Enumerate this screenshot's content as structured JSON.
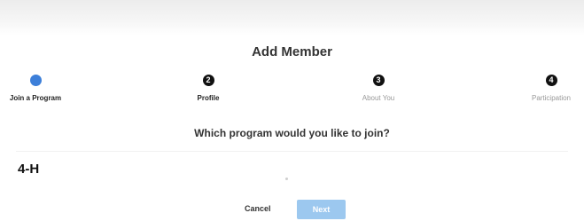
{
  "dialog": {
    "title": "Add Member"
  },
  "steps": [
    {
      "number": "",
      "label": "Join a Program",
      "state": "active"
    },
    {
      "number": "2",
      "label": "Profile",
      "state": "pending"
    },
    {
      "number": "3",
      "label": "About You",
      "state": "pending"
    },
    {
      "number": "4",
      "label": "Participation",
      "state": "pending"
    }
  ],
  "question": "Which program would you like to join?",
  "options": [
    {
      "label": "4-H"
    }
  ],
  "actions": {
    "cancel_label": "Cancel",
    "next_label": "Next"
  },
  "colors": {
    "accent": "#3d7fd9",
    "next_button_disabled": "#9cc8ef",
    "step_circle": "#111111"
  }
}
